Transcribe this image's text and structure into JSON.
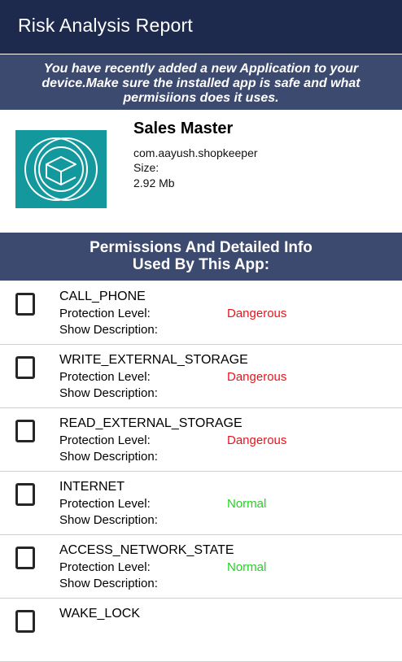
{
  "appbar": {
    "title": "Risk Analysis Report"
  },
  "notice": {
    "text": "You have recently added a new Application to your device.Make sure the installed app is safe and what permisiions does it uses."
  },
  "app": {
    "name": "Sales Master",
    "package": "com.aayush.shopkeeper",
    "size_label": "Size:",
    "size": "2.92 Mb",
    "icon": "sales-master-logo-icon"
  },
  "permissions_header": {
    "line1": "Permissions And Detailed Info",
    "line2": "Used By This App:"
  },
  "labels": {
    "protection_level": "Protection Level:",
    "show_description": "Show Description:"
  },
  "colors": {
    "dangerous": "#e8141c",
    "normal": "#21d421",
    "appbar": "#1d2a4d",
    "banner": "#3c4a6f",
    "icon_bg": "#13989d"
  },
  "permissions": [
    {
      "name": "CALL_PHONE",
      "level": "Dangerous"
    },
    {
      "name": "WRITE_EXTERNAL_STORAGE",
      "level": "Dangerous"
    },
    {
      "name": "READ_EXTERNAL_STORAGE",
      "level": "Dangerous"
    },
    {
      "name": "INTERNET",
      "level": "Normal"
    },
    {
      "name": "ACCESS_NETWORK_STATE",
      "level": "Normal"
    },
    {
      "name": "WAKE_LOCK",
      "level": ""
    }
  ]
}
